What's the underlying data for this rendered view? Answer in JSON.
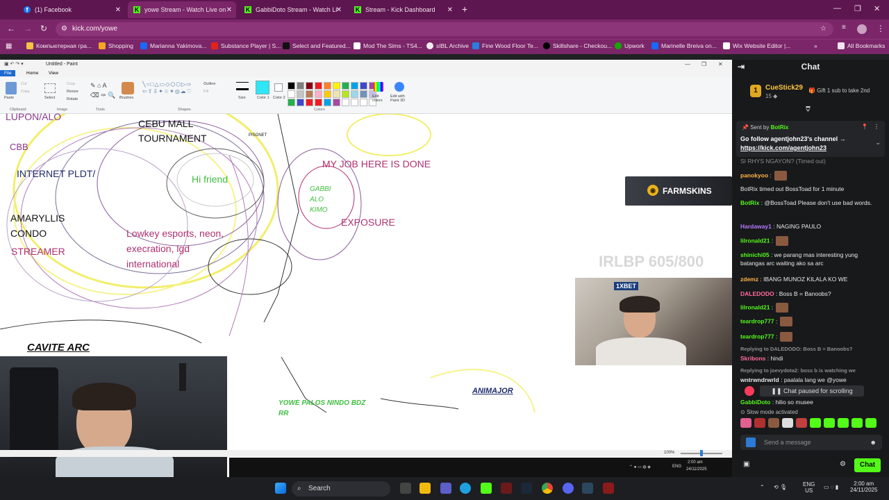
{
  "browser": {
    "tabs": [
      {
        "label": "(1) Facebook",
        "icon": "facebook-icon"
      },
      {
        "label": "yowe Stream - Watch Live on K",
        "icon": "kick-icon",
        "active": true
      },
      {
        "label": "GabbiDoto Stream - Watch Live",
        "icon": "kick-icon"
      },
      {
        "label": "Stream - Kick Dashboard",
        "icon": "kick-icon"
      }
    ],
    "url": "kick.com/yowe",
    "bookmarks": [
      "Компьютерная гра...",
      "Shopping",
      "Marianna Yakimova...",
      "Substance Player | S...",
      "Select and Featured...",
      "Mod The Sims - TS4...",
      "sIBL Archive",
      "Fine Wood Floor Te...",
      "Skillshare - Checkou...",
      "Upwork",
      "Marinelle Breiva on...",
      "Wix Website Editor |..."
    ],
    "all_bookmarks": "All Bookmarks"
  },
  "paint": {
    "title": "Untitled - Paint",
    "tabs": [
      "File",
      "Home",
      "View"
    ],
    "groups": [
      "Clipboard",
      "Image",
      "Tools",
      "Shapes",
      "Colors"
    ],
    "clipboard": {
      "paste": "Paste",
      "cut": "Cut",
      "copy": "Copy"
    },
    "image": {
      "select": "Select",
      "crop": "Crop",
      "resize": "Resize",
      "rotate": "Rotate"
    },
    "tools": {
      "brushes": "Brushes"
    },
    "shapes": {
      "outline": "Outline",
      "fill": "Fill"
    },
    "size": "Size",
    "color1": "Color 1",
    "color2": "Color 2",
    "edit_colors": "Edit colors",
    "edit_paint3d": "Edit with Paint 3D",
    "zoom": "100%",
    "palette": [
      "#000000",
      "#7f7f7f",
      "#880015",
      "#ed1c24",
      "#ff7f27",
      "#fff200",
      "#22b14c",
      "#00a2e8",
      "#3f48cc",
      "#a349a4",
      "#ffffff",
      "#c3c3c3",
      "#b97a57",
      "#ffaec9",
      "#ffc90e",
      "#efe4b0",
      "#b5e61d",
      "#99d9ea",
      "#7092be",
      "#c8bfe7",
      "#22b14c",
      "#3f48cc",
      "#ed1c24",
      "#ed1c24",
      "#00a2e8",
      "#a349a4",
      "#ffffff",
      "#ffffff",
      "#ffffff",
      "#ffffff"
    ]
  },
  "canvas": {
    "labels": [
      {
        "text": "LUPON/ALO",
        "color": "#8a3a8a"
      },
      {
        "text": "CEBU MALL",
        "color": "#111111"
      },
      {
        "text": "TOURNAMENT",
        "color": "#111111"
      },
      {
        "text": "PISONET",
        "color": "#111111"
      },
      {
        "text": "CBB",
        "color": "#8a3a8a"
      },
      {
        "text": "INTERNET PLDT/",
        "color": "#1d2a6a"
      },
      {
        "text": "Hi friend",
        "color": "#3fbf3f"
      },
      {
        "text": "MY JOB HERE IS DONE",
        "color": "#b03070"
      },
      {
        "text": "GABBI",
        "color": "#3fbf3f"
      },
      {
        "text": "ALO",
        "color": "#3fbf3f"
      },
      {
        "text": "KIMO",
        "color": "#3fbf3f"
      },
      {
        "text": "AMARYLLIS",
        "color": "#111111"
      },
      {
        "text": "CONDO",
        "color": "#111111"
      },
      {
        "text": "EXPOSURE",
        "color": "#b03070"
      },
      {
        "text": "STREAMER",
        "color": "#b03070"
      },
      {
        "text": "Lowkey esports, neon,",
        "color": "#b03070"
      },
      {
        "text": "execration, lgd",
        "color": "#b03070"
      },
      {
        "text": "international",
        "color": "#b03070"
      },
      {
        "text": "CAVITE ARC",
        "color": "#111111"
      },
      {
        "text": "YOWE PALOS NINDO BDZ",
        "color": "#3fbf3f"
      },
      {
        "text": "RR",
        "color": "#3fbf3f"
      },
      {
        "text": "ANIMAJOR",
        "color": "#1d2a6a"
      }
    ],
    "overlay_farmskins": "FARMSKINS",
    "overlay_irl": "IRLBP 605/800",
    "overlay_1xbet": "1XBET"
  },
  "inner_taskbar": {
    "lang": "ENG",
    "time": "2:00 am",
    "date": "24/11/2025"
  },
  "chat": {
    "title": "Chat",
    "gifter": {
      "name": "CueStick29",
      "count": "15",
      "gift_text": "Gift 1 sub to take 2nd"
    },
    "pinned": {
      "sent_by_label": "Sent by",
      "sender": "BotRix",
      "line1": "Go follow agentjohn23's channel →",
      "line2": "https://kick.com/agentjohn23"
    },
    "messages": [
      {
        "user": "SI RHYS NGAYON?",
        "text": "(Timed out)",
        "color": "#8d8d8d"
      },
      {
        "user": "panokyoo",
        "text": ":",
        "color": "#ffb347"
      },
      {
        "user": "",
        "text": "BotRix timed out BossToad for 1 minute",
        "color": "#e9e9e9"
      },
      {
        "user": "BotRix",
        "text": ": @BossToad Please don't use bad words.",
        "color": "#53fc18"
      },
      {
        "user": "Hardaway1",
        "text": ": NAGING PAULO",
        "color": "#b57aff"
      },
      {
        "user": "lilronald21",
        "text": ":",
        "color": "#53fc18"
      },
      {
        "user": "shinichi05",
        "text": ": we parang mas interesting yung batangas arc waiting ako sa arc",
        "color": "#53fc18"
      },
      {
        "user": "zdemz",
        "text": ": IBANG MUNOZ KILALA KO WE",
        "color": "#ffb347"
      },
      {
        "user": "DALEDODO",
        "text": ": Boss B = Banoobs?",
        "color": "#ff6b9a"
      },
      {
        "user": "lilronald21",
        "text": ":",
        "color": "#53fc18"
      },
      {
        "user": "teardrop777",
        "text": ":",
        "color": "#53fc18"
      },
      {
        "user": "teardrop777",
        "text": ":",
        "color": "#53fc18"
      },
      {
        "user": "Replying to DALEDODO: Boss B = Banoobs?",
        "text": "",
        "color": "#8d8d8d"
      },
      {
        "user": "Skribons",
        "text": ": hindi",
        "color": "#ff6b9a"
      },
      {
        "user": "Replying to joevydota2: boss b is watching we",
        "text": "",
        "color": "#8d8d8d"
      },
      {
        "user": "wntrwndrwrld",
        "text": ": paalala lang we @yowe",
        "color": "#e9e9e9"
      },
      {
        "user": "GabbiDoto",
        "text": ": hilio so musee",
        "color": "#53fc18"
      }
    ],
    "paused_label": "Chat paused for scrolling",
    "slow_mode": "Slow mode activated",
    "input_placeholder": "Send a message",
    "chat_button": "Chat"
  },
  "taskbar": {
    "search": "Search",
    "lang": "ENG",
    "region": "US",
    "time": "2:00 am",
    "date": "24/11/2025"
  }
}
